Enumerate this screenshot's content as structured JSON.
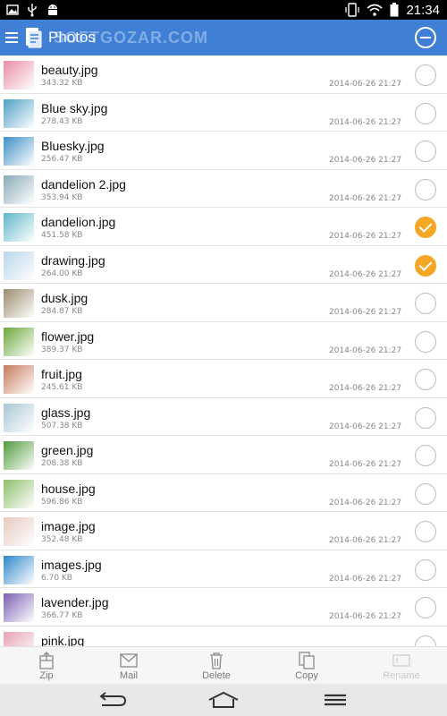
{
  "status_bar": {
    "time": "21:34",
    "icons": [
      "image-icon",
      "usb-icon",
      "android-icon",
      "phone-rotate-icon",
      "wifi-icon",
      "battery-icon"
    ]
  },
  "app_bar": {
    "title": "Photos",
    "watermark_text": "SOFTGOZAR.COM",
    "icons": [
      "menu-icon",
      "app-logo-icon",
      "deselect-all-icon"
    ],
    "color": "#3f80d6"
  },
  "files": [
    {
      "name": "beauty.jpg",
      "size": "343.32 KB",
      "date": "2014-06-26 21:27",
      "selected": false,
      "thumb_color": "#e98fa6"
    },
    {
      "name": "Blue sky.jpg",
      "size": "278.43 KB",
      "date": "2014-06-26 21:27",
      "selected": false,
      "thumb_color": "#4d9fc4"
    },
    {
      "name": "Bluesky.jpg",
      "size": "256.47 KB",
      "date": "2014-06-26 21:27",
      "selected": false,
      "thumb_color": "#3d8fc6"
    },
    {
      "name": "dandelion 2.jpg",
      "size": "353.94 KB",
      "date": "2014-06-26 21:27",
      "selected": false,
      "thumb_color": "#8aa9b7"
    },
    {
      "name": "dandelion.jpg",
      "size": "451.58 KB",
      "date": "2014-06-26 21:27",
      "selected": true,
      "thumb_color": "#5fb7c9"
    },
    {
      "name": "drawing.jpg",
      "size": "264.00 KB",
      "date": "2014-06-26 21:27",
      "selected": true,
      "thumb_color": "#b9d6ea"
    },
    {
      "name": "dusk.jpg",
      "size": "284.87 KB",
      "date": "2014-06-26 21:27",
      "selected": false,
      "thumb_color": "#9b8c6d"
    },
    {
      "name": "flower.jpg",
      "size": "389.37 KB",
      "date": "2014-06-26 21:27",
      "selected": false,
      "thumb_color": "#6aa83a"
    },
    {
      "name": "fruit.jpg",
      "size": "245.61 KB",
      "date": "2014-06-26 21:27",
      "selected": false,
      "thumb_color": "#c67a5b"
    },
    {
      "name": "glass.jpg",
      "size": "507.38 KB",
      "date": "2014-06-26 21:27",
      "selected": false,
      "thumb_color": "#a9c7d6"
    },
    {
      "name": "green.jpg",
      "size": "208.38 KB",
      "date": "2014-06-26 21:27",
      "selected": false,
      "thumb_color": "#4f9a3b"
    },
    {
      "name": "house.jpg",
      "size": "596.86 KB",
      "date": "2014-06-26 21:27",
      "selected": false,
      "thumb_color": "#8dbf6b"
    },
    {
      "name": "image.jpg",
      "size": "352.48 KB",
      "date": "2014-06-26 21:27",
      "selected": false,
      "thumb_color": "#e7c9c0"
    },
    {
      "name": "images.jpg",
      "size": "6.70 KB",
      "date": "2014-06-26 21:27",
      "selected": false,
      "thumb_color": "#2f86c9"
    },
    {
      "name": "lavender.jpg",
      "size": "366.77 KB",
      "date": "2014-06-26 21:27",
      "selected": false,
      "thumb_color": "#7b5fb4"
    },
    {
      "name": "pink.jpg",
      "size": "",
      "date": "",
      "selected": false,
      "thumb_color": "#e7a4b4"
    }
  ],
  "toolbar": {
    "items": [
      {
        "label": "Zip",
        "icon": "zip-icon",
        "enabled": true
      },
      {
        "label": "Mail",
        "icon": "mail-icon",
        "enabled": true
      },
      {
        "label": "Delete",
        "icon": "trash-icon",
        "enabled": true
      },
      {
        "label": "Copy",
        "icon": "copy-icon",
        "enabled": true
      },
      {
        "label": "Rename",
        "icon": "rename-icon",
        "enabled": false
      }
    ]
  },
  "nav_bar": {
    "buttons": [
      "back-icon",
      "home-icon",
      "menu-lines-icon"
    ]
  },
  "colors": {
    "accent": "#3f80d6",
    "selected_check": "#f5a623"
  }
}
